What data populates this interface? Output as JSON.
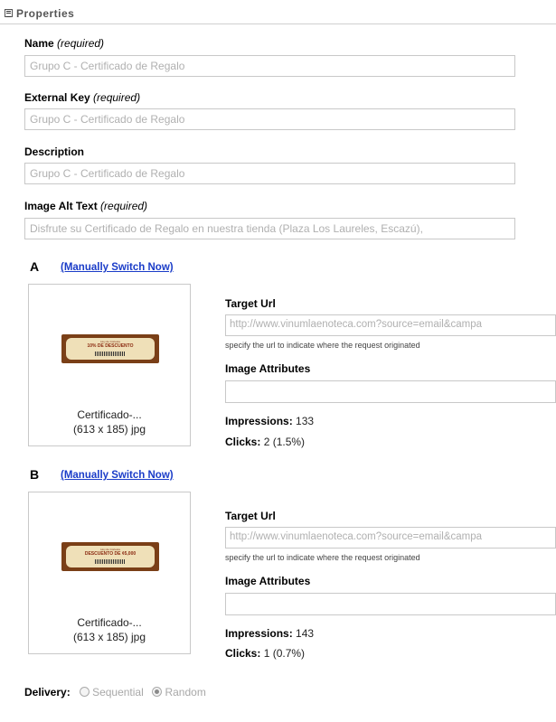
{
  "section": {
    "title": "Properties"
  },
  "fields": {
    "name": {
      "label": "Name",
      "required": "(required)",
      "value": "Grupo C - Certificado de Regalo"
    },
    "external_key": {
      "label": "External Key",
      "required": "(required)",
      "value": "Grupo C - Certificado de Regalo"
    },
    "description": {
      "label": "Description",
      "value": "Grupo C - Certificado de Regalo"
    },
    "alt_text": {
      "label": "Image Alt Text",
      "required": "(required)",
      "value": "Disfrute su Certificado de Regalo en nuestra tienda (Plaza Los Laureles, Escazú),"
    }
  },
  "variants": [
    {
      "letter": "A",
      "switch_link": "(Manually Switch Now)",
      "image_line1": "Hoy de Cortesia",
      "image_line2": "10% DE DESCUENTO",
      "file_name": "Certificado-...",
      "file_meta": "(613 x 185) jpg",
      "target_url_label": "Target Url",
      "target_url": "http://www.vinumlaenoteca.com?source=email&campa",
      "help": "specify the url to indicate where the request originated",
      "attributes_label": "Image Attributes",
      "impressions_label": "Impressions:",
      "impressions": "133",
      "clicks_label": "Clicks:",
      "clicks": "2 (1.5%)"
    },
    {
      "letter": "B",
      "switch_link": "(Manually Switch Now)",
      "image_line1": "Hoy de Cortesia",
      "image_line2": "DESCUENTO DE ¢5,000",
      "file_name": "Certificado-...",
      "file_meta": "(613 x 185) jpg",
      "target_url_label": "Target Url",
      "target_url": "http://www.vinumlaenoteca.com?source=email&campa",
      "help": "specify the url to indicate where the request originated",
      "attributes_label": "Image Attributes",
      "impressions_label": "Impressions:",
      "impressions": "143",
      "clicks_label": "Clicks:",
      "clicks": "1 (0.7%)"
    }
  ],
  "delivery": {
    "label": "Delivery:",
    "options": [
      "Sequential",
      "Random"
    ],
    "selected": "Random"
  },
  "colors": {
    "link": "#1a3cc8",
    "placeholder": "#b0b0b0",
    "image_frame": "#7a3f17"
  }
}
